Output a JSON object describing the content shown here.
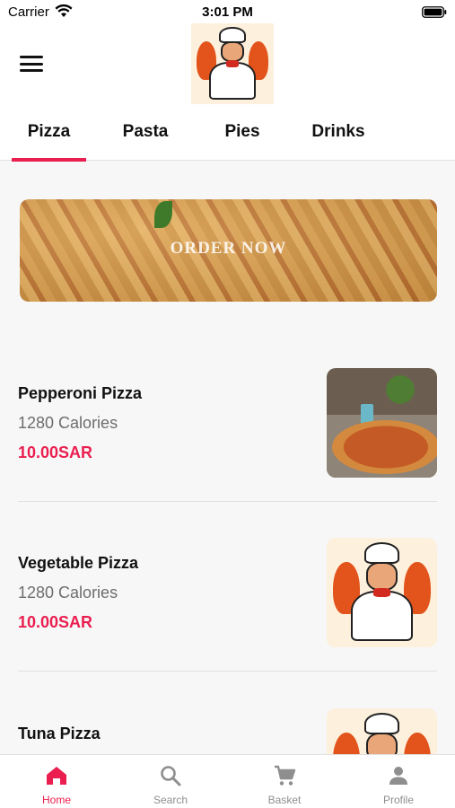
{
  "status_bar": {
    "carrier": "Carrier",
    "time": "3:01 PM"
  },
  "header": {
    "menu_icon": "hamburger-icon",
    "logo_icon": "chef-mascot-logo"
  },
  "tabs": [
    {
      "label": "Pizza",
      "active": true
    },
    {
      "label": "Pasta",
      "active": false
    },
    {
      "label": "Pies",
      "active": false
    },
    {
      "label": "Drinks",
      "active": false
    }
  ],
  "banner": {
    "text": "ORDER NOW"
  },
  "menu_items": [
    {
      "name": "Pepperoni Pizza",
      "calories": "1280 Calories",
      "price": "10.00SAR"
    },
    {
      "name": "Vegetable Pizza",
      "calories": "1280 Calories",
      "price": "10.00SAR"
    },
    {
      "name": "Tuna Pizza"
    }
  ],
  "bottom_nav": [
    {
      "label": "Home",
      "icon": "home-icon",
      "active": true
    },
    {
      "label": "Search",
      "icon": "search-icon",
      "active": false
    },
    {
      "label": "Basket",
      "icon": "cart-icon",
      "active": false
    },
    {
      "label": "Profile",
      "icon": "person-icon",
      "active": false
    }
  ],
  "colors": {
    "accent": "#ea1e4f",
    "background": "#f7f7f7",
    "inactive": "#8e8e8e"
  }
}
